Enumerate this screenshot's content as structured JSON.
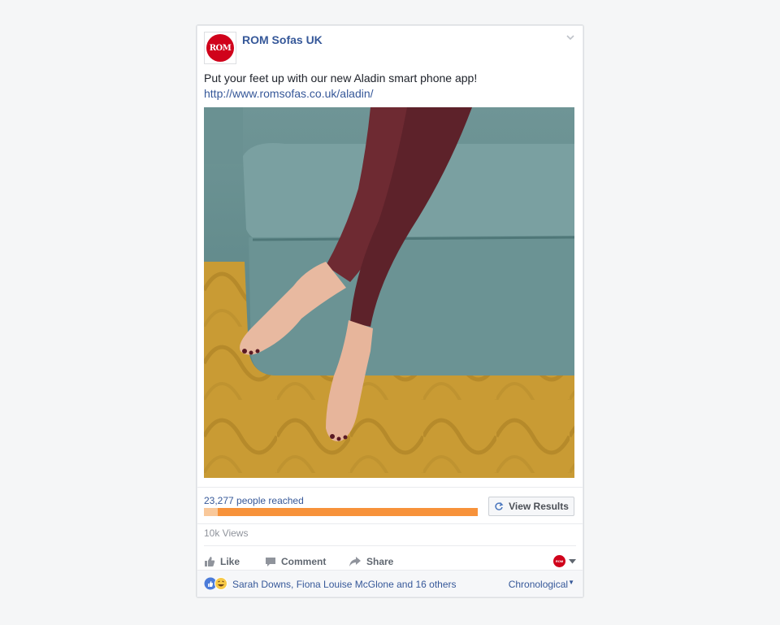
{
  "post": {
    "page_name": "ROM Sofas UK",
    "logo_text": "ROM",
    "message": "Put your feet up with our new Aladin smart phone app!",
    "link": "http://www.romsofas.co.uk/aladin/"
  },
  "poll": {
    "reach_text": "23,277 people reached",
    "progress": 0.05,
    "view_results_label": "View Results"
  },
  "stats": {
    "views": "10k Views"
  },
  "actions": {
    "like": "Like",
    "comment": "Comment",
    "share": "Share"
  },
  "footer": {
    "reactors": "Sarah Downs, Fiona Louise McGlone and 16 others",
    "sort": "Chronological"
  },
  "colors": {
    "brand_red": "#d0021b",
    "link_blue": "#365899",
    "progress_orange": "#f7923a"
  }
}
